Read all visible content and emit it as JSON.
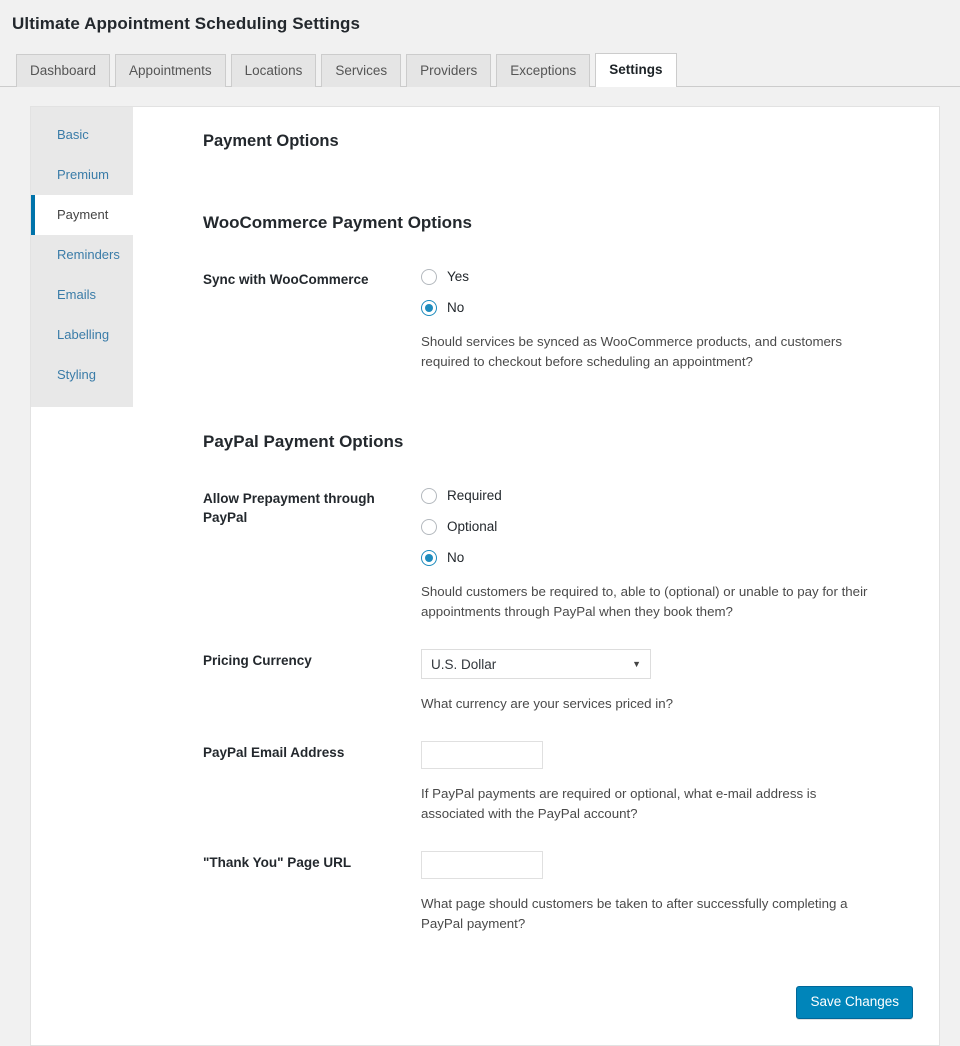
{
  "header": {
    "title": "Ultimate Appointment Scheduling Settings"
  },
  "tabs": [
    {
      "label": "Dashboard",
      "active": false
    },
    {
      "label": "Appointments",
      "active": false
    },
    {
      "label": "Locations",
      "active": false
    },
    {
      "label": "Services",
      "active": false
    },
    {
      "label": "Providers",
      "active": false
    },
    {
      "label": "Exceptions",
      "active": false
    },
    {
      "label": "Settings",
      "active": true
    }
  ],
  "sidebar": {
    "items": [
      {
        "label": "Basic",
        "active": false
      },
      {
        "label": "Premium",
        "active": false
      },
      {
        "label": "Payment",
        "active": true
      },
      {
        "label": "Reminders",
        "active": false
      },
      {
        "label": "Emails",
        "active": false
      },
      {
        "label": "Labelling",
        "active": false
      },
      {
        "label": "Styling",
        "active": false
      }
    ]
  },
  "main": {
    "page_heading": "Payment Options",
    "woocommerce": {
      "group_title": "WooCommerce Payment Options",
      "sync": {
        "label": "Sync with WooCommerce",
        "options": [
          {
            "label": "Yes",
            "checked": false
          },
          {
            "label": "No",
            "checked": true
          }
        ],
        "help": "Should services be synced as WooCommerce products, and customers required to checkout before scheduling an appointment?"
      }
    },
    "paypal": {
      "group_title": "PayPal Payment Options",
      "prepayment": {
        "label": "Allow Prepayment through PayPal",
        "options": [
          {
            "label": "Required",
            "checked": false
          },
          {
            "label": "Optional",
            "checked": false
          },
          {
            "label": "No",
            "checked": true
          }
        ],
        "help": "Should customers be required to, able to (optional) or unable to pay for their appointments through PayPal when they book them?"
      },
      "currency": {
        "label": "Pricing Currency",
        "selected": "U.S. Dollar",
        "arrow": "▼",
        "help": "What currency are your services priced in?"
      },
      "email": {
        "label": "PayPal Email Address",
        "value": "",
        "placeholder": "",
        "help": "If PayPal payments are required or optional, what e-mail address is associated with the PayPal account?"
      },
      "thank_you_url": {
        "label": "\"Thank You\" Page URL",
        "value": "",
        "placeholder": "",
        "help": "What page should customers be taken to after successfully completing a PayPal payment?"
      }
    },
    "save_label": "Save Changes"
  },
  "colors": {
    "accent": "#0073aa",
    "button": "#0085ba",
    "radio_checked": "#1e8cbe",
    "link": "#3a7ca8",
    "page_bg": "#f1f1f1",
    "sidebar_bg": "#e8e8e8"
  }
}
